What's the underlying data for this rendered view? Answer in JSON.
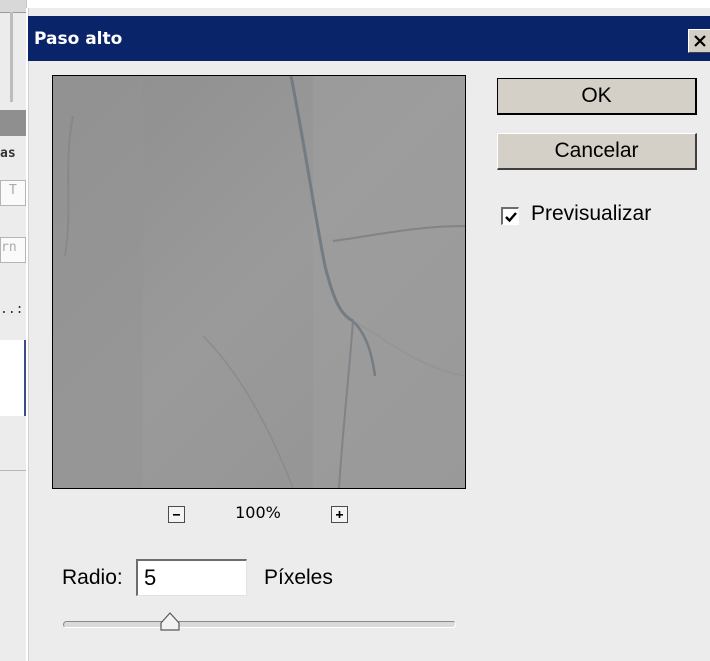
{
  "background_app": {
    "fragments": [
      "as",
      "T",
      "rn",
      "..:"
    ]
  },
  "dialog": {
    "title": "Paso alto",
    "close_icon": "close-x-icon",
    "preview": {
      "zoom_out_icon": "minus-icon",
      "zoom_in_icon": "plus-icon",
      "zoom_level": "100%"
    },
    "radius": {
      "label": "Radio:",
      "value": "5",
      "unit": "Píxeles"
    },
    "slider": {
      "thumb_icon": "slider-thumb-icon"
    },
    "buttons": {
      "ok": "OK",
      "cancel": "Cancelar"
    },
    "preview_toggle": {
      "label": "Previsualizar",
      "checked": true
    }
  },
  "colors": {
    "titlebar": "#0a246a",
    "dialog_bg": "#ececec",
    "button_face": "#d4d0c8"
  }
}
